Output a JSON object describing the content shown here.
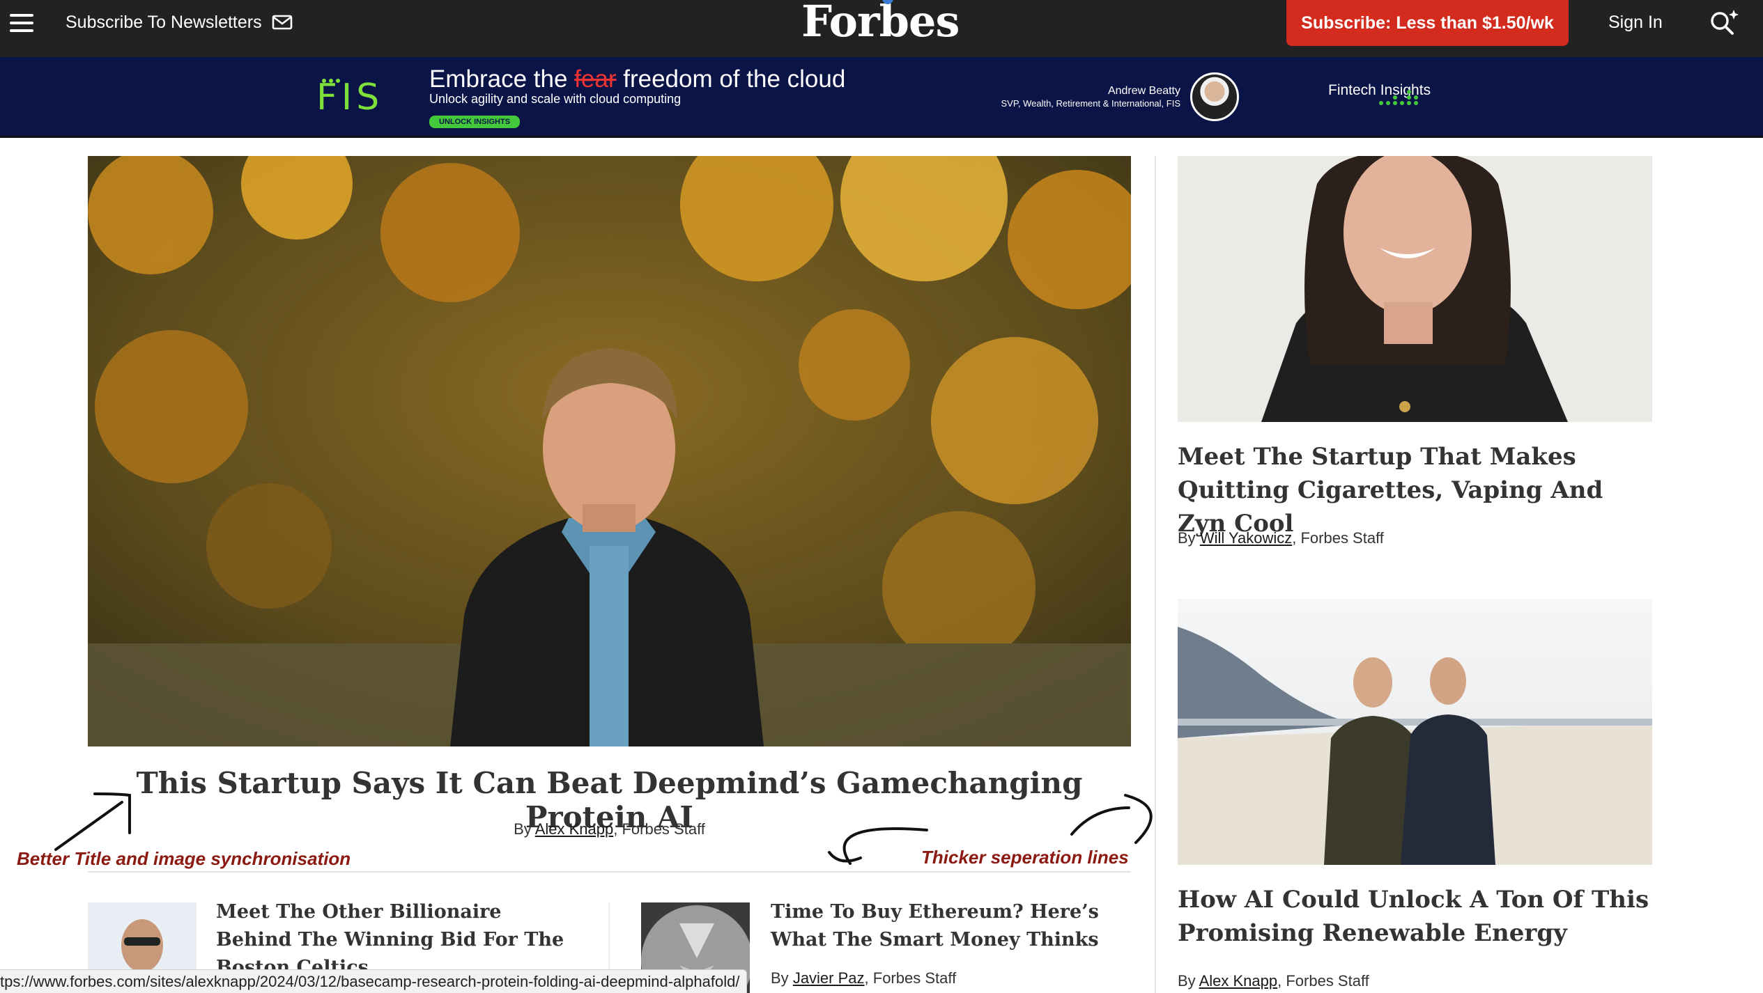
{
  "nav": {
    "newsletter_label": "Subscribe To Newsletters",
    "logo": "Forbes",
    "subscribe_label": "Subscribe: Less than $1.50/wk",
    "signin_label": "Sign In",
    "bg_color": "#222222",
    "accent_color": "#d32b1e"
  },
  "ad": {
    "brand": "FIS",
    "headline_pre": "Embrace the",
    "headline_struck": "fear",
    "headline_post": "freedom of the cloud",
    "subhead": "Unlock agility and scale with cloud computing",
    "cta": "UNLOCK INSIGHTS",
    "person_name": "Andrew Beatty",
    "person_title": "SVP, Wealth, Retirement & International, FIS",
    "series": "Fintech Insights",
    "bg_color": "#0b1446"
  },
  "hero": {
    "title": "This Startup Says It Can Beat Deepmind’s Gamechanging Protein AI",
    "by": "By",
    "author": "Alex Knapp",
    "staff": ", Forbes Staff"
  },
  "annotations": {
    "left": "Better Title and image synchronisation",
    "right": "Thicker seperation lines",
    "color": "#8b1a12"
  },
  "stories": [
    {
      "title": "Meet The Other Billionaire Behind The Winning Bid For The Boston Celtics"
    },
    {
      "title": "Time To Buy Ethereum? Here’s What The Smart Money Thinks",
      "by": "By",
      "author": "Javier Paz",
      "staff": ", Forbes Staff"
    }
  ],
  "side": [
    {
      "title": "Meet The Startup That Makes Quitting Cigarettes, Vaping And Zyn Cool",
      "by": "By",
      "author": "Will Yakowicz",
      "staff": ", Forbes Staff"
    },
    {
      "title": "How AI Could Unlock A Ton Of This Promising Renewable Energy",
      "by": "By",
      "author": "Alex Knapp",
      "staff": ", Forbes Staff"
    }
  ],
  "status_url": "tps://www.forbes.com/sites/alexknapp/2024/03/12/basecamp-research-protein-folding-ai-deepmind-alphafold/"
}
